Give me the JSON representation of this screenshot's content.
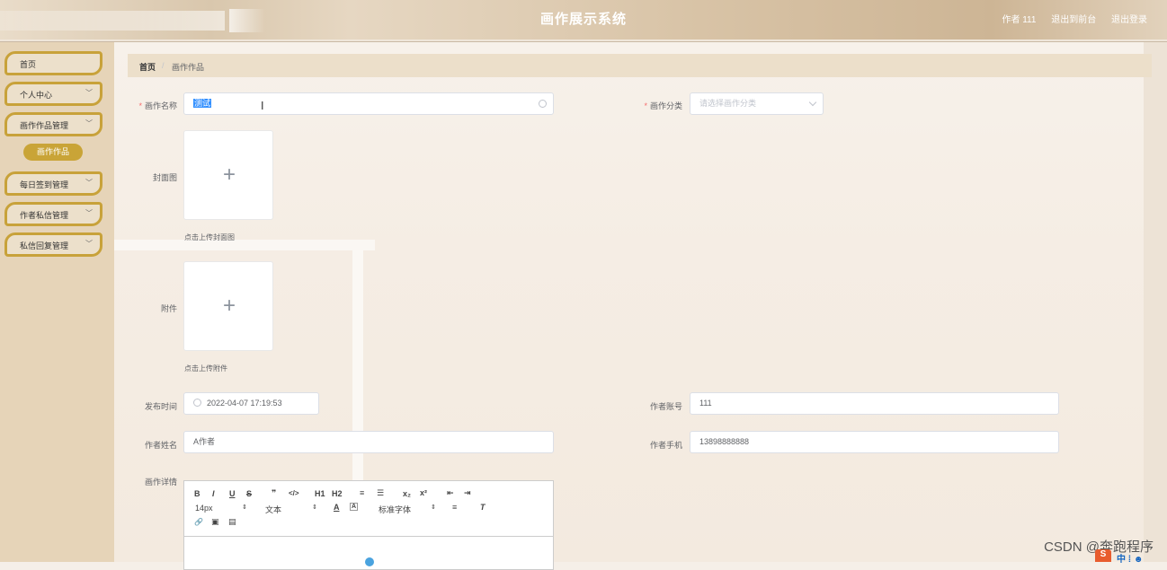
{
  "header": {
    "title": "画作展示系统",
    "user_label": "作者 111",
    "back_label": "退出到前台",
    "logout_label": "退出登录"
  },
  "sidebar": {
    "items": [
      {
        "label": "首页"
      },
      {
        "label": "个人中心",
        "chevron": "﹀"
      },
      {
        "label": "画作作品管理",
        "chevron": "﹀"
      },
      {
        "label": "画作作品"
      },
      {
        "label": "每日签到管理",
        "chevron": "﹀"
      },
      {
        "label": "作者私信管理",
        "chevron": "﹀"
      },
      {
        "label": "私信回复管理",
        "chevron": "﹀"
      }
    ]
  },
  "breadcrumb": {
    "home": "首页",
    "sep": "/",
    "current": "画作作品"
  },
  "form": {
    "required_mark": "*",
    "name": {
      "label": "画作名称",
      "value": "测试"
    },
    "category": {
      "label": "画作分类",
      "placeholder": "请选择画作分类"
    },
    "cover": {
      "label": "封面图",
      "plus": "+",
      "tip": "点击上传封面图"
    },
    "attachment": {
      "label": "附件",
      "plus": "+",
      "tip": "点击上传附件"
    },
    "publish_time": {
      "label": "发布时间",
      "value": "2022-04-07 17:19:53"
    },
    "author_account": {
      "label": "作者账号",
      "value": "111"
    },
    "author_name": {
      "label": "作者姓名",
      "value": "A作者"
    },
    "author_phone": {
      "label": "作者手机",
      "value": "13898888888"
    },
    "details": {
      "label": "画作详情"
    }
  },
  "editor": {
    "bold": "B",
    "italic": "I",
    "underline": "U",
    "strike": "S",
    "quote": "❞",
    "code": "</>",
    "h1": "H1",
    "h2": "H2",
    "ordered_list": "≡",
    "bullet_list": "☰",
    "subscript": "x₂",
    "superscript": "x²",
    "outdent": "⇤",
    "indent": "⇥",
    "size": "14px",
    "text_type": "文本",
    "font_color": "A",
    "bg_color": "A",
    "font_family": "标准字体",
    "align": "≡",
    "clear": "T",
    "link": "🔗",
    "image": "▣",
    "video": "▤",
    "arrow": "⇕"
  },
  "watermark": "CSDN @奔跑程序",
  "tray": {
    "app": "S",
    "text": "中 ⁞ ☻"
  }
}
